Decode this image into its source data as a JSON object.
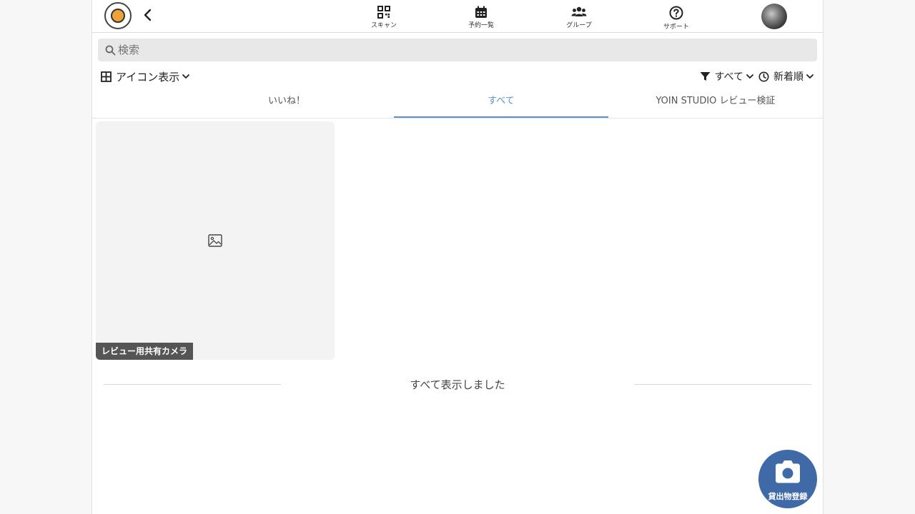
{
  "header": {
    "logo_icon": "app-logo",
    "back_icon": "chevron-left-icon",
    "nav": [
      {
        "label": "スキャン",
        "icon": "qr-code-icon"
      },
      {
        "label": "予約一覧",
        "icon": "calendar-icon"
      },
      {
        "label": "グループ",
        "icon": "users-icon"
      },
      {
        "label": "サポート",
        "icon": "question-circle-icon"
      }
    ],
    "avatar_icon": "user-avatar"
  },
  "search": {
    "placeholder": "検索",
    "value": ""
  },
  "toolbar": {
    "view_mode_label": "アイコン表示",
    "filter_label": "すべて",
    "sort_label": "新着順"
  },
  "tabs": [
    {
      "label": "いいね！",
      "active": false
    },
    {
      "label": "すべて",
      "active": true
    },
    {
      "label": "YOIN STUDIO レビュー検証",
      "active": false
    }
  ],
  "items": [
    {
      "label": "レビュー用共有カメラ",
      "image": "image-placeholder-icon"
    }
  ],
  "list_end_text": "すべて表示しました",
  "fab": {
    "label": "貸出物登録",
    "icon": "camera-icon"
  },
  "colors": {
    "accent": "#5d8fc9",
    "fab": "#3f6aa7",
    "search_bg": "#e8e8e8",
    "card_bg": "#f3f3f3"
  }
}
